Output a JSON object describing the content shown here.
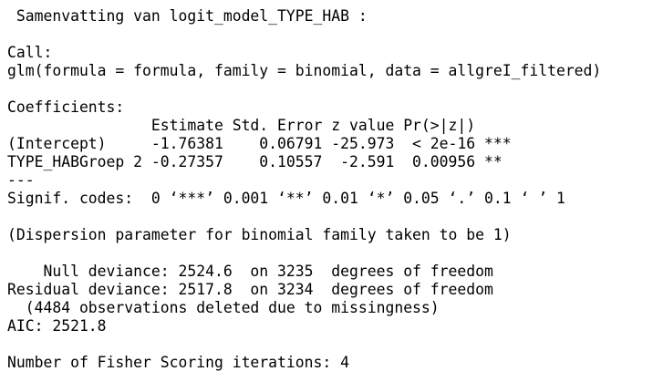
{
  "console": {
    "lines": [
      " Samenvatting van logit_model_TYPE_HAB :",
      "",
      "Call:",
      "glm(formula = formula, family = binomial, data = allgreI_filtered)",
      "",
      "Coefficients:",
      "                Estimate Std. Error z value Pr(>|z|)    ",
      "(Intercept)     -1.76381    0.06791 -25.973  < 2e-16 ***",
      "TYPE_HABGroep 2 -0.27357    0.10557  -2.591  0.00956 ** ",
      "---",
      "Signif. codes:  0 ‘***’ 0.001 ‘**’ 0.01 ‘*’ 0.05 ‘.’ 0.1 ‘ ’ 1",
      "",
      "(Dispersion parameter for binomial family taken to be 1)",
      "",
      "    Null deviance: 2524.6  on 3235  degrees of freedom",
      "Residual deviance: 2517.8  on 3234  degrees of freedom",
      "  (4484 observations deleted due to missingness)",
      "AIC: 2521.8",
      "",
      "Number of Fisher Scoring iterations: 4"
    ]
  }
}
